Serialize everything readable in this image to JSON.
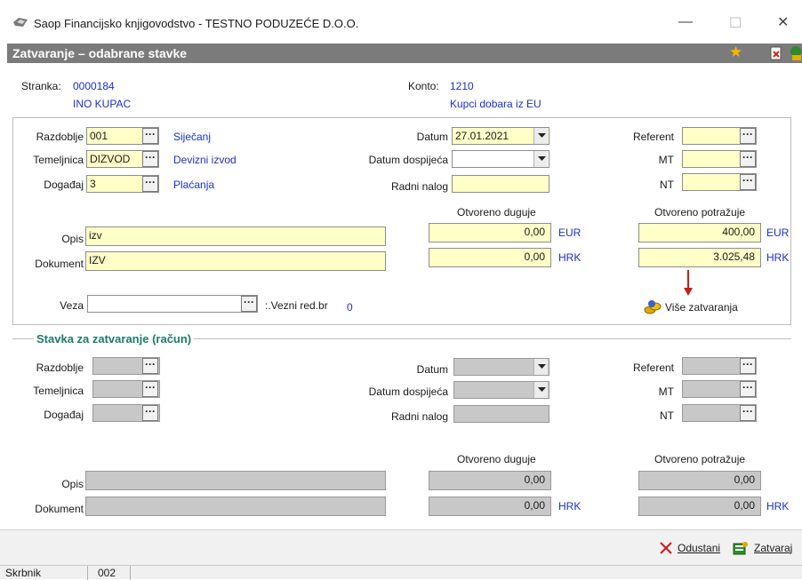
{
  "window": {
    "title": "Saop Financijsko knjigovodstvo - TESTNO PODUZEĆE D.O.O.",
    "minimize": "—",
    "maximize": "☐",
    "close": "✕"
  },
  "form": {
    "title": "Zatvaranje – odabrane stavke",
    "header_colors": {
      "bar": "#7b7b7b"
    }
  },
  "top": {
    "stranka_label": "Stranka:",
    "stranka_value": "0000184",
    "stranka_name": "INO KUPAC",
    "konto_label": "Konto:",
    "konto_value": "1210",
    "konto_name": "Kupci dobara iz EU"
  },
  "upper": {
    "razdoblje_label": "Razdoblje",
    "razdoblje_value": "001",
    "razdoblje_name": "Siječanj",
    "temeljnica_label": "Temeljnica",
    "temeljnica_value": "DIZVOD",
    "temeljnica_name": "Devizni izvod",
    "dogadaj_label": "Događaj",
    "dogadaj_value": "3",
    "dogadaj_name": "Plaćanja",
    "datum_label": "Datum",
    "datum_value": "27.01.2021",
    "datum_dospijeca_label": "Datum dospijeća",
    "datum_dospijeca_value": "",
    "radni_nalog_label": "Radni nalog",
    "radni_nalog_value": "",
    "referent_label": "Referent",
    "mt_label": "MT",
    "nt_label": "NT",
    "otvoreno_duguje_label": "Otvoreno duguje",
    "otvoreno_potrazuje_label": "Otvoreno potražuje",
    "duguje_eur": "0,00",
    "duguje_hrk": "0,00",
    "potrazuje_eur": "400,00",
    "potrazuje_hrk": "3.025,48",
    "cur_eur": "EUR",
    "cur_hrk": "HRK",
    "opis_label": "Opis",
    "opis_value": "izv",
    "dokument_label": "Dokument",
    "dokument_value": "IZV",
    "veza_label": "Veza",
    "veza_value": "",
    "vezni_label": ":.Vezni red.br",
    "vezni_value": "0",
    "vise_zatvaranja": "Više zatvaranja"
  },
  "lower": {
    "group_title": "Stavka za zatvaranje (račun)",
    "razdoblje_label": "Razdoblje",
    "temeljnica_label": "Temeljnica",
    "dogadaj_label": "Događaj",
    "datum_label": "Datum",
    "datum_dospijeca_label": "Datum dospijeća",
    "radni_nalog_label": "Radni nalog",
    "referent_label": "Referent",
    "mt_label": "MT",
    "nt_label": "NT",
    "otvoreno_duguje_label": "Otvoreno duguje",
    "otvoreno_potrazuje_label": "Otvoreno potražuje",
    "duguje_1": "0,00",
    "duguje_2": "0,00",
    "potrazuje_1": "0,00",
    "potrazuje_2": "0,00",
    "cur_hrk": "HRK",
    "opis_label": "Opis",
    "dokument_label": "Dokument"
  },
  "footer": {
    "odustani": "Odustani",
    "zatvaraj": "Zatvaraj"
  },
  "statusbar": {
    "label": "Skrbnik",
    "value": "002"
  },
  "icons": [
    "app-logo-icon",
    "star-icon",
    "document-delete-icon",
    "money-icon",
    "red-arrow-icon",
    "coins-icon",
    "close-x-icon",
    "close-ledger-icon"
  ]
}
